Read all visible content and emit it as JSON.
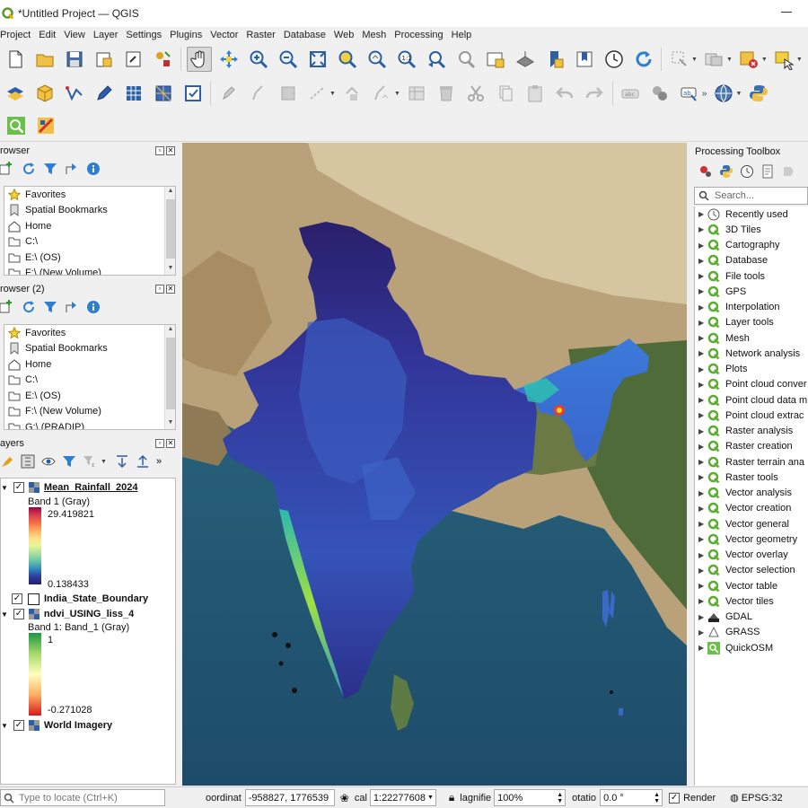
{
  "window": {
    "title": "*Untitled Project — QGIS"
  },
  "menu": [
    "Project",
    "Edit",
    "View",
    "Layer",
    "Settings",
    "Plugins",
    "Vector",
    "Raster",
    "Database",
    "Web",
    "Mesh",
    "Processing",
    "Help"
  ],
  "browser": {
    "title": "rowser",
    "items": [
      "Favorites",
      "Spatial Bookmarks",
      "Home",
      "C:\\",
      "E:\\ (OS)",
      "F:\\ (New Volume)"
    ]
  },
  "browser2": {
    "title": "rowser (2)",
    "items": [
      "Favorites",
      "Spatial Bookmarks",
      "Home",
      "C:\\",
      "E:\\ (OS)",
      "F:\\ (New Volume)",
      "G:\\ (PRADIP)"
    ]
  },
  "layers": {
    "title": "ayers",
    "rainfall": {
      "name": "Mean_Rainfall_2024",
      "band": "Band 1 (Gray)",
      "max": "29.419821",
      "min": "0.138433"
    },
    "boundary": {
      "name": "India_State_Boundary"
    },
    "ndvi": {
      "name": "ndvi_USING_liss_4",
      "band": "Band 1: Band_1 (Gray)",
      "max": "1",
      "min": "-0.271028"
    },
    "imagery": {
      "name": "World Imagery"
    }
  },
  "processing": {
    "title": "Processing Toolbox",
    "search_placeholder": "Search...",
    "items": [
      "Recently used",
      "3D Tiles",
      "Cartography",
      "Database",
      "File tools",
      "GPS",
      "Interpolation",
      "Layer tools",
      "Mesh",
      "Network analysis",
      "Plots",
      "Point cloud conver",
      "Point cloud data m",
      "Point cloud extrac",
      "Raster analysis",
      "Raster creation",
      "Raster terrain ana",
      "Raster tools",
      "Vector analysis",
      "Vector creation",
      "Vector general",
      "Vector geometry",
      "Vector overlay",
      "Vector selection",
      "Vector table",
      "Vector tiles",
      "GDAL",
      "GRASS",
      "QuickOSM"
    ]
  },
  "status": {
    "locate_placeholder": "Type to locate (Ctrl+K)",
    "coord_label": "oordinat",
    "coord_value": "-958827, 1776539",
    "scale_label": "cal",
    "scale_value": "1:22277608",
    "magnifier_label": "lagnifie",
    "magnifier_value": "100%",
    "rotation_label": "otatio",
    "rotation_value": "0.0 °",
    "render_label": "Render",
    "crs": "EPSG:32"
  }
}
